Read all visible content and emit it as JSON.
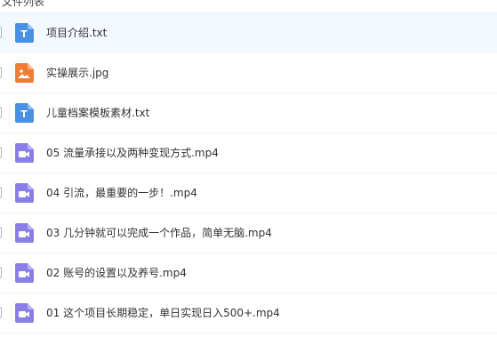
{
  "header": {
    "title_fragment": "文件列表"
  },
  "colors": {
    "text_icon": "#4a90e2",
    "image_icon": "#f07d33",
    "video_icon": "#8a7fe8",
    "hover_row": "#f4f9ff"
  },
  "files": [
    {
      "name": "项目介绍.txt",
      "icon": "text-file-icon"
    },
    {
      "name": "实操展示.jpg",
      "icon": "image-file-icon"
    },
    {
      "name": "儿童档案模板素材.txt",
      "icon": "text-file-icon"
    },
    {
      "name": "05 流量承接以及两种变现方式.mp4",
      "icon": "video-file-icon"
    },
    {
      "name": "04 引流，最重要的一步！.mp4",
      "icon": "video-file-icon"
    },
    {
      "name": "03 几分钟就可以完成一个作品，简单无脑.mp4",
      "icon": "video-file-icon"
    },
    {
      "name": "02 账号的设置以及养号.mp4",
      "icon": "video-file-icon"
    },
    {
      "name": "01 这个项目长期稳定，单日实现日入500+.mp4",
      "icon": "video-file-icon"
    }
  ]
}
